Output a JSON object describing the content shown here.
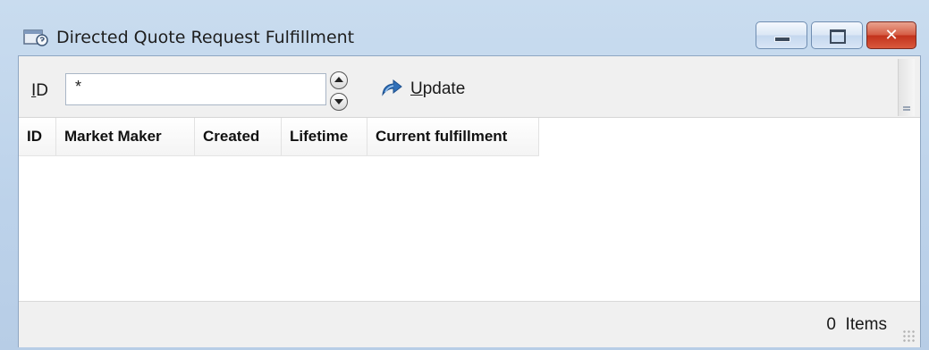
{
  "window": {
    "title": "Directed Quote Request Fulfillment",
    "icon": "quote-request-window-icon",
    "controls": [
      "minimize-icon",
      "maximize-icon",
      "close-icon"
    ],
    "close_glyph": "✕"
  },
  "toolbar": {
    "id_label_mnemonic": "I",
    "id_label_rest": "D",
    "id_value": "*",
    "update_icon": "update-arrow-icon",
    "update_label_mnemonic": "U",
    "update_label_rest": "pdate"
  },
  "grid": {
    "columns": [
      "ID",
      "Market Maker",
      "Created",
      "Lifetime",
      "Current fulfillment"
    ],
    "rows": []
  },
  "status": {
    "count": "0",
    "label": "Items"
  },
  "colors": {
    "frame": "#bcd2ea",
    "close_button": "#c2321c",
    "client_background": "#f0f0f0"
  }
}
